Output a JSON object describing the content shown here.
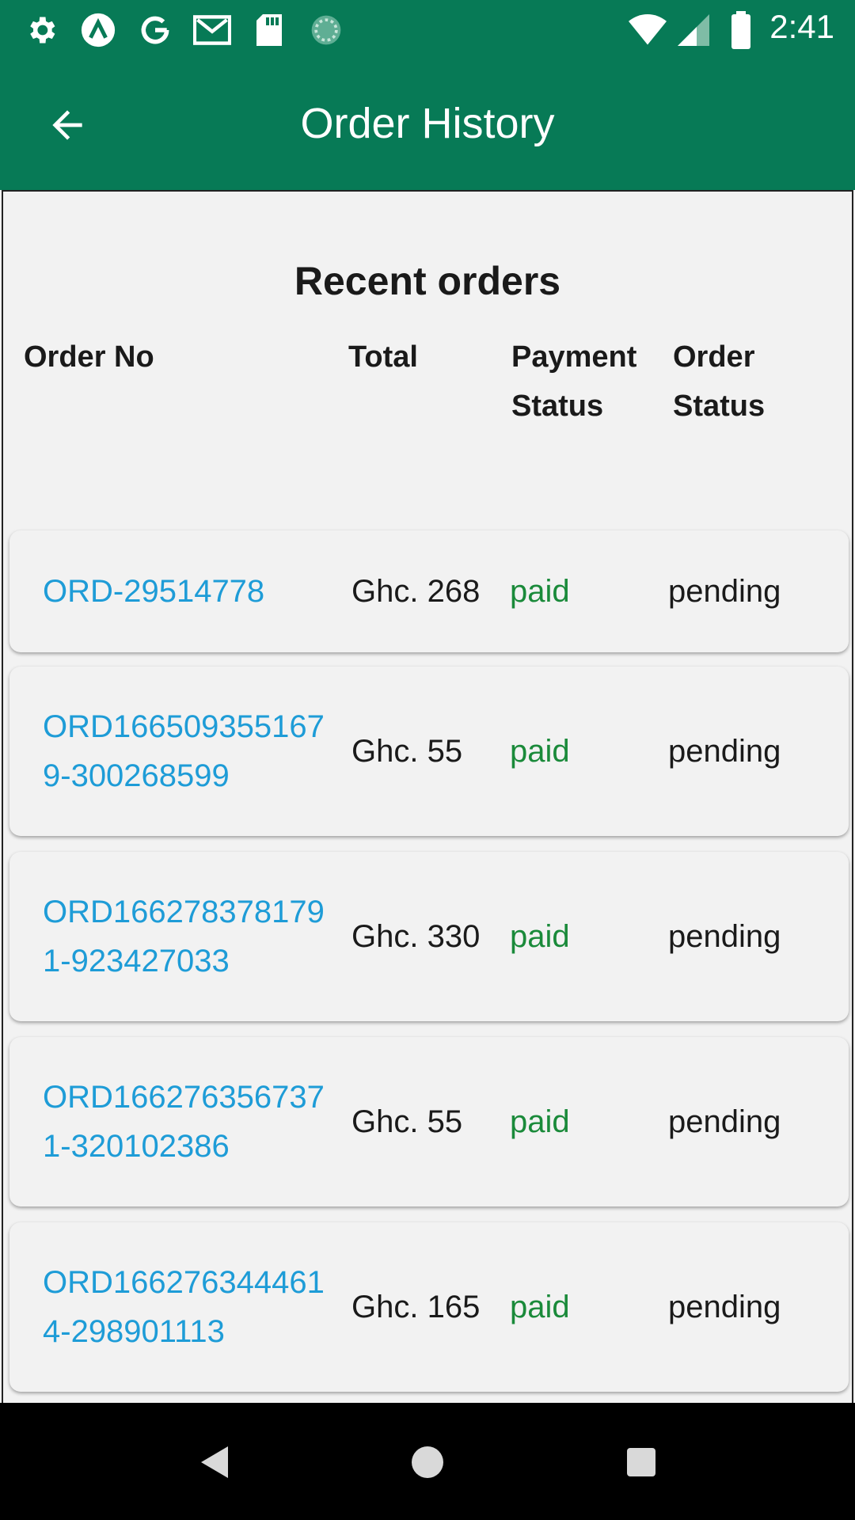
{
  "status_bar": {
    "time": "2:41",
    "left_icons": [
      "settings-icon",
      "app-a-icon",
      "google-g-icon",
      "gmail-icon",
      "sd-card-icon",
      "loading-circle-icon"
    ],
    "right_icons": [
      "wifi-icon",
      "cell-signal-icon",
      "battery-icon"
    ]
  },
  "app_bar": {
    "title": "Order History",
    "back_icon": "arrow-back-icon"
  },
  "section": {
    "title": "Recent orders"
  },
  "table": {
    "headers": {
      "order_no": "Order No",
      "total": "Total",
      "payment_status_1": "Payment",
      "payment_status_2": "Status",
      "order_status_1": "Order",
      "order_status_2": "Status"
    },
    "rows": [
      {
        "order_no_1": "ORD-29514778",
        "order_no_2": "",
        "total": "Ghc. 268",
        "payment": "paid",
        "status": "pending"
      },
      {
        "order_no_1": "ORD166509355167",
        "order_no_2": "9-300268599",
        "total": "Ghc. 55",
        "payment": "paid",
        "status": "pending"
      },
      {
        "order_no_1": "ORD166278378179",
        "order_no_2": "1-923427033",
        "total": "Ghc. 330",
        "payment": "paid",
        "status": "pending"
      },
      {
        "order_no_1": "ORD166276356737",
        "order_no_2": "1-320102386",
        "total": "Ghc. 55",
        "payment": "paid",
        "status": "pending"
      },
      {
        "order_no_1": "ORD166276344461",
        "order_no_2": "4-298901113",
        "total": "Ghc. 165",
        "payment": "paid",
        "status": "pending"
      }
    ]
  },
  "colors": {
    "primary": "#077a56",
    "link": "#1e9cd7",
    "paid": "#1a8a3a",
    "background": "#f2f2f2"
  },
  "nav_bar": {
    "icons": [
      "nav-back-icon",
      "nav-home-icon",
      "nav-recents-icon"
    ]
  }
}
